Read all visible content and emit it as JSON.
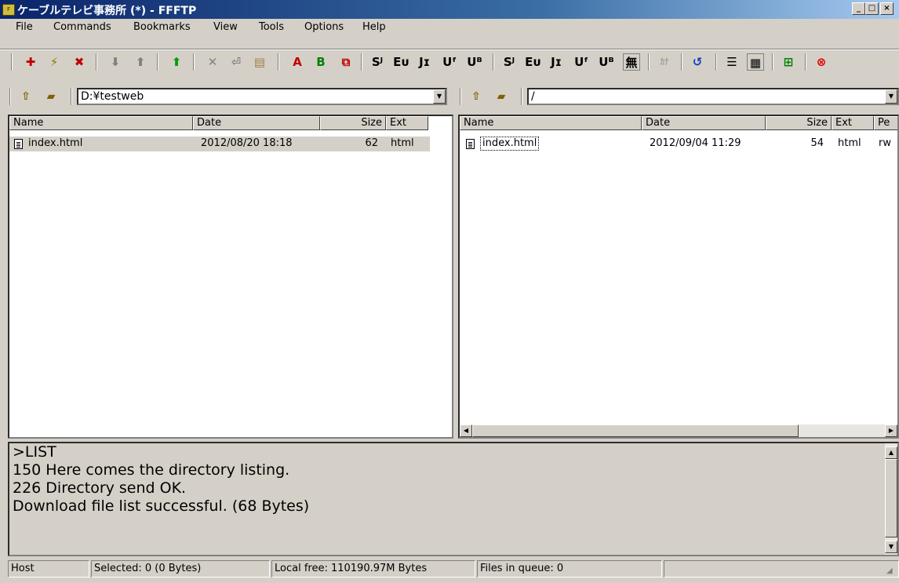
{
  "window": {
    "title": "ケーブルテレビ事務所 (*) - FFFTP",
    "icon": "ffftp-app-icon"
  },
  "caption_buttons": {
    "minimize": "_",
    "maximize": "□",
    "close": "×"
  },
  "menu": [
    "File",
    "Commands",
    "Bookmarks",
    "View",
    "Tools",
    "Options",
    "Help"
  ],
  "toolbar": {
    "buttons": [
      {
        "name": "connect-icon",
        "glyph": "✚",
        "color": "#c00000"
      },
      {
        "name": "quick-connect-icon",
        "glyph": "⚡",
        "color": "#808000"
      },
      {
        "name": "disconnect-icon",
        "glyph": "✖",
        "color": "#c00000"
      },
      {
        "name": "download-icon",
        "glyph": "⬇",
        "color": "#808080"
      },
      {
        "name": "upload-icon",
        "glyph": "⬆",
        "color": "#808080"
      },
      {
        "name": "mirror-upload-icon",
        "glyph": "⬆",
        "color": "#00a000"
      },
      {
        "name": "delete-icon",
        "glyph": "✕",
        "color": "#808080"
      },
      {
        "name": "rename-icon",
        "glyph": "⏎",
        "color": "#808080"
      },
      {
        "name": "make-directory-icon",
        "glyph": "▤",
        "color": "#a08040"
      },
      {
        "name": "ascii-mode-icon",
        "glyph": "A",
        "color": "#c00000"
      },
      {
        "name": "binary-mode-icon",
        "glyph": "B",
        "color": "#008000"
      },
      {
        "name": "auto-mode-icon",
        "glyph": "⧉",
        "color": "#c00000"
      },
      {
        "name": "host-sjis-icon",
        "glyph": "Sᴶ",
        "color": "#000"
      },
      {
        "name": "host-euc-icon",
        "glyph": "Eᴜ",
        "color": "#000"
      },
      {
        "name": "host-jis-icon",
        "glyph": "Jɪ",
        "color": "#000"
      },
      {
        "name": "host-utf8-icon",
        "glyph": "Uᶠ",
        "color": "#000"
      },
      {
        "name": "host-utf8bom-icon",
        "glyph": "Uᴮ",
        "color": "#000"
      },
      {
        "name": "local-sjis-icon",
        "glyph": "Sᴶ",
        "color": "#000"
      },
      {
        "name": "local-euc-icon",
        "glyph": "Eᴜ",
        "color": "#000"
      },
      {
        "name": "local-jis-icon",
        "glyph": "Jɪ",
        "color": "#000"
      },
      {
        "name": "local-utf8-icon",
        "glyph": "Uᶠ",
        "color": "#000"
      },
      {
        "name": "local-utf8bom-icon",
        "glyph": "Uᴮ",
        "color": "#000"
      },
      {
        "name": "no-conversion-icon",
        "glyph": "無",
        "color": "#000"
      },
      {
        "name": "kana-conversion-icon",
        "glyph": "ｶﾅ",
        "color": "#a0a0a0"
      },
      {
        "name": "refresh-icon",
        "glyph": "↺",
        "color": "#1040c0"
      },
      {
        "name": "list-view-icon",
        "glyph": "☰",
        "color": "#000"
      },
      {
        "name": "detail-view-icon",
        "glyph": "▦",
        "color": "#000"
      },
      {
        "name": "sync-folders-icon",
        "glyph": "⊞",
        "color": "#008000"
      },
      {
        "name": "stop-icon",
        "glyph": "⊗",
        "color": "#e00000"
      }
    ]
  },
  "local": {
    "path": "D:¥testweb",
    "headers": {
      "name": "Name",
      "date": "Date",
      "size": "Size",
      "ext": "Ext"
    },
    "rows": [
      {
        "name": "index.html",
        "date": "2012/08/20 18:18",
        "size": "62",
        "ext": "html"
      }
    ]
  },
  "remote": {
    "path": "/",
    "headers": {
      "name": "Name",
      "date": "Date",
      "size": "Size",
      "ext": "Ext",
      "perm": "Pe"
    },
    "rows": [
      {
        "name": "index.html",
        "date": "2012/09/04 11:29",
        "size": "54",
        "ext": "html",
        "perm": "rw"
      }
    ]
  },
  "log": {
    "lines": [
      ">LIST",
      "150 Here comes the directory listing.",
      "226 Directory send OK.",
      "Download file list successful. (68 Bytes)"
    ]
  },
  "statusbar": {
    "host": "Host",
    "selected": "Selected: 0 (0 Bytes)",
    "local_free": "Local free: 110190.97M Bytes",
    "queue": "Files in queue: 0"
  }
}
